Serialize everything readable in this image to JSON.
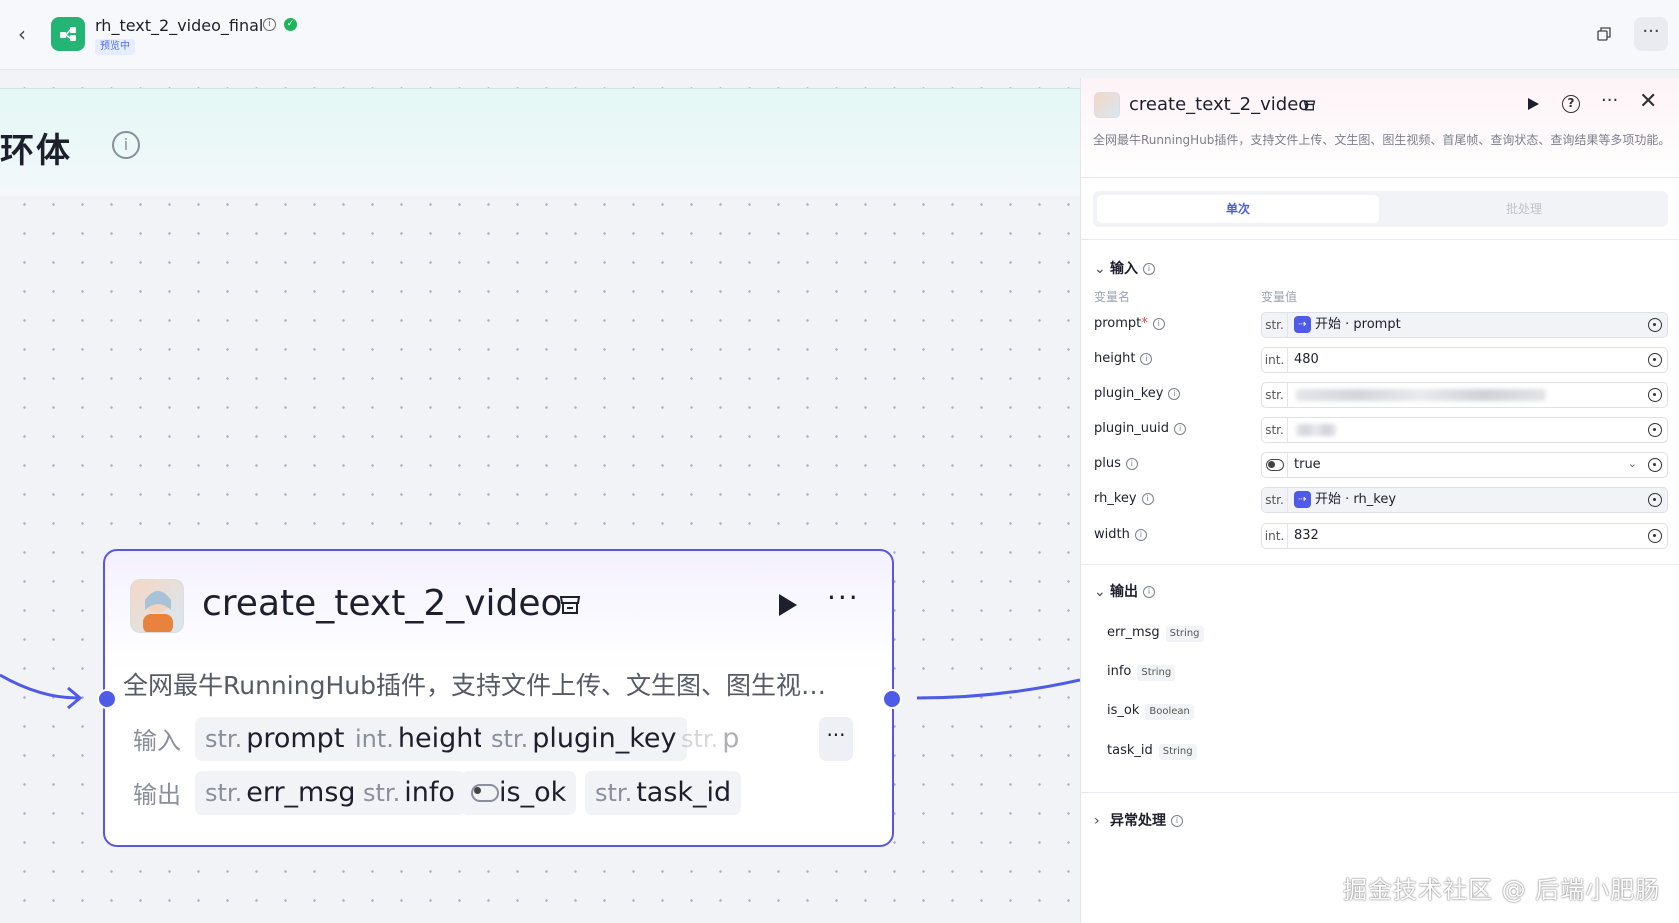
{
  "topbar": {
    "back_icon": "chevron-left-icon",
    "app_title": "rh_text_2_video_final",
    "status_tag": "预览中",
    "info_icon": "info-icon",
    "verified_icon": "check-circle-icon"
  },
  "canvas": {
    "loop_title": "循环体",
    "node": {
      "title": "create_text_2_video",
      "description": "全网最牛RunningHub插件，支持文件上传、文生图、图生视…",
      "input_label": "输入",
      "output_label": "输出",
      "inputs": [
        {
          "type": "str.",
          "name": "prompt"
        },
        {
          "type": "int.",
          "name": "height"
        },
        {
          "type": "str.",
          "name": "plugin_key"
        },
        {
          "type": "str.",
          "name": "p"
        }
      ],
      "outputs": [
        {
          "type": "str.",
          "name": "err_msg"
        },
        {
          "type": "str.",
          "name": "info"
        },
        {
          "type": "toggle",
          "name": "is_ok"
        },
        {
          "type": "str.",
          "name": "task_id"
        }
      ]
    }
  },
  "panel": {
    "title": "create_text_2_video",
    "description": "全网最牛RunningHub插件，支持文件上传、文生图、图生视频、首尾帧、查询状态、查询结果等多项功能。",
    "tabs": [
      {
        "label": "单次"
      },
      {
        "label": "批处理"
      }
    ],
    "input_section": "输入",
    "col_name": "变量名",
    "col_value": "变量值",
    "params": [
      {
        "name": "prompt",
        "required": "*",
        "type": "str.",
        "ref_prefix": "开始",
        "value": "prompt"
      },
      {
        "name": "height",
        "type": "int.",
        "value": "480"
      },
      {
        "name": "plugin_key",
        "type": "str.",
        "value": ""
      },
      {
        "name": "plugin_uuid",
        "type": "str.",
        "value": ""
      },
      {
        "name": "plus",
        "type": "toggle",
        "value": "true"
      },
      {
        "name": "rh_key",
        "type": "str.",
        "ref_prefix": "开始",
        "value": "rh_key"
      },
      {
        "name": "width",
        "type": "int.",
        "value": "832"
      }
    ],
    "output_section": "输出",
    "outputs": [
      {
        "name": "err_msg",
        "type": "String"
      },
      {
        "name": "info",
        "type": "String"
      },
      {
        "name": "is_ok",
        "type": "Boolean"
      },
      {
        "name": "task_id",
        "type": "String"
      }
    ],
    "error_section": "异常处理"
  },
  "watermark": "掘金技术社区 @ 后端小肥肠",
  "colors": {
    "accent": "#4d5be8",
    "node_border": "#5a55e6",
    "success": "#1fb35a",
    "app_logo": "#22b573"
  }
}
